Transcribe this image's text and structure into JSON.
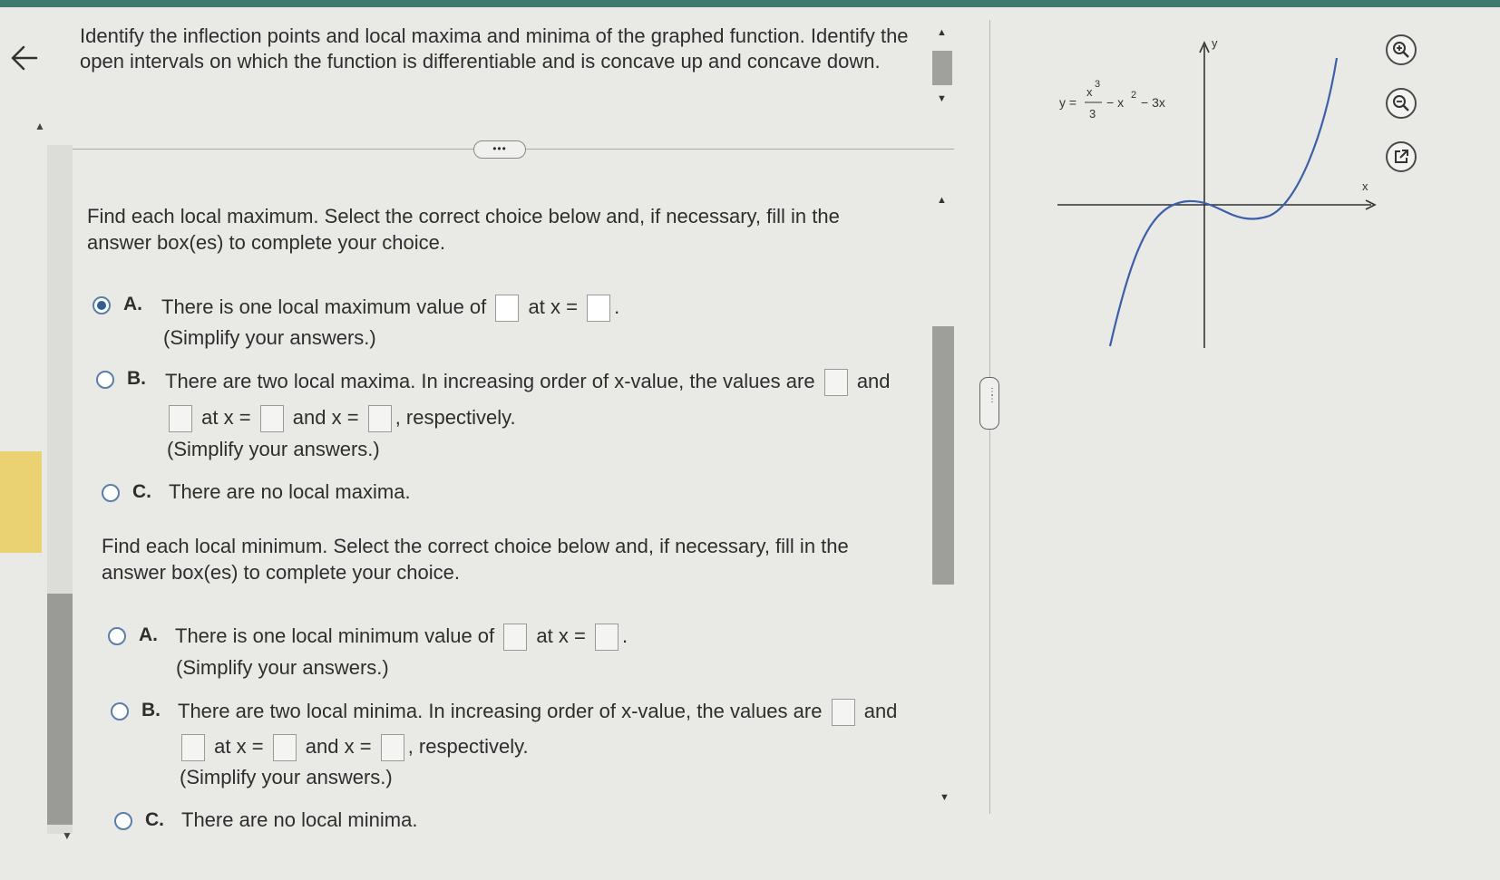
{
  "question": {
    "text": "Identify the inflection points and local maxima and minima of the graphed function. Identify the open intervals on which the function is differentiable and is concave up and concave down."
  },
  "more_label": "•••",
  "max_section": {
    "prompt": "Find each local maximum. Select the correct choice below and, if necessary, fill in the answer box(es) to complete your choice.",
    "selected": "A",
    "options": {
      "a": {
        "letter": "A.",
        "text1": "There is one local maximum value of",
        "text2": "at x =",
        "text3": ".",
        "note": "(Simplify your answers.)"
      },
      "b": {
        "letter": "B.",
        "text1": "There are two local maxima. In increasing order of x-value, the values are",
        "text2": "and",
        "text3": "at x =",
        "text4": "and x =",
        "text5": ", respectively.",
        "note": "(Simplify your answers.)"
      },
      "c": {
        "letter": "C.",
        "text": "There are no local maxima."
      }
    }
  },
  "min_section": {
    "prompt": "Find each local minimum. Select the correct choice below and, if necessary, fill in the answer box(es) to complete your choice.",
    "options": {
      "a": {
        "letter": "A.",
        "text1": "There is one local minimum value of",
        "text2": "at x =",
        "text3": ".",
        "note": "(Simplify your answers.)"
      },
      "b": {
        "letter": "B.",
        "text1": "There are two local minima. In increasing order of x-value, the values are",
        "text2": "and",
        "text3": "at x =",
        "text4": "and x =",
        "text5": ", respectively.",
        "note": "(Simplify your answers.)"
      },
      "c": {
        "letter": "C.",
        "text": "There are no local minima."
      }
    }
  },
  "graph": {
    "equation_lhs": "y =",
    "equation_num": "x",
    "equation_num_exp": "3",
    "equation_den": "3",
    "equation_rest": "− x",
    "equation_rest_exp": "2",
    "equation_tail": "− 3x",
    "x_label": "x",
    "y_label": "y"
  },
  "tools": {
    "zoom_in": "zoom-in-icon",
    "zoom_out": "zoom-out-icon",
    "popout": "external-link-icon"
  },
  "colors": {
    "curve": "#3b5fa8",
    "accent": "#3d7c6d",
    "radio": "#2e5f96",
    "yellow_tab": "#ead172"
  }
}
